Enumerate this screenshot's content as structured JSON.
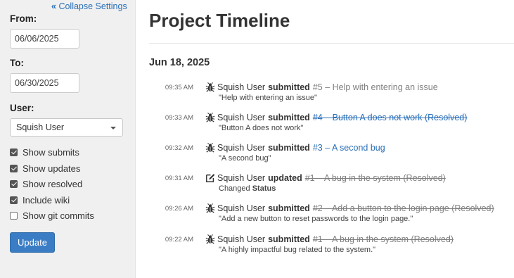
{
  "sidebar": {
    "collapse_label": "Collapse Settings",
    "from_label": "From:",
    "from_value": "06/06/2025",
    "to_label": "To:",
    "to_value": "06/30/2025",
    "user_label": "User:",
    "user_selected": "Squish User",
    "checkboxes": [
      {
        "label": "Show submits",
        "checked": true
      },
      {
        "label": "Show updates",
        "checked": true
      },
      {
        "label": "Show resolved",
        "checked": true
      },
      {
        "label": "Include wiki",
        "checked": true
      },
      {
        "label": "Show git commits",
        "checked": false
      }
    ],
    "update_label": "Update"
  },
  "main": {
    "title": "Project Timeline",
    "date_heading": "Jun 18, 2025",
    "entries": [
      {
        "time": "09:35 AM",
        "icon": "bug-icon",
        "user": "Squish User",
        "action": "submitted",
        "ref": "#5 – Help with entering an issue",
        "ref_style": "gray",
        "resolved": false,
        "desc": "\"Help with entering an issue\""
      },
      {
        "time": "09:33 AM",
        "icon": "bug-icon",
        "user": "Squish User",
        "action": "submitted",
        "ref": "#4 – Button A does not work (Resolved)",
        "ref_style": "blue",
        "resolved": true,
        "desc": "\"Button A does not work\""
      },
      {
        "time": "09:32 AM",
        "icon": "bug-icon",
        "user": "Squish User",
        "action": "submitted",
        "ref": "#3 – A second bug",
        "ref_style": "blue",
        "resolved": false,
        "desc": "\"A second bug\""
      },
      {
        "time": "09:31 AM",
        "icon": "edit-icon",
        "user": "Squish User",
        "action": "updated",
        "ref": "#1 – A bug in the system (Resolved)",
        "ref_style": "gray",
        "resolved": true,
        "desc_prefix": "Changed",
        "desc_field": "Status"
      },
      {
        "time": "09:26 AM",
        "icon": "bug-icon",
        "user": "Squish User",
        "action": "submitted",
        "ref": "#2 – Add a button to the login page (Resolved)",
        "ref_style": "gray",
        "resolved": true,
        "desc": "\"Add a new button to reset passwords to the login page.\""
      },
      {
        "time": "09:22 AM",
        "icon": "bug-icon",
        "user": "Squish User",
        "action": "submitted",
        "ref": "#1 – A bug in the system (Resolved)",
        "ref_style": "gray",
        "resolved": true,
        "desc": "\"A highly impactful bug related to the system.\""
      }
    ]
  },
  "colors": {
    "link_blue": "#2a6fb8",
    "muted_gray": "#7f7f7f",
    "button_blue": "#3a7dc4",
    "sidebar_bg": "#f0f0f0"
  }
}
